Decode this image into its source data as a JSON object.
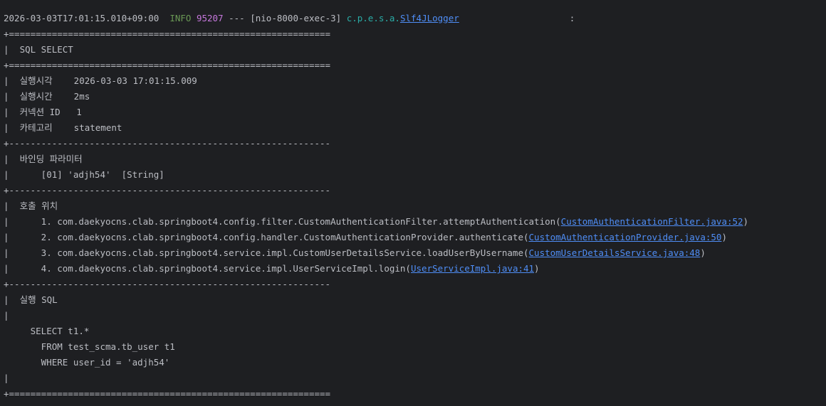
{
  "header": {
    "timestamp": "2026-03-03T17:01:15.010+09:00",
    "level": "INFO",
    "pid": "95207",
    "separator": "---",
    "thread": "[nio-8000-exec-3]",
    "logger_prefix": "c.p.e.s.a.",
    "logger_class": "Slf4JLogger",
    "colon": ":"
  },
  "borders": {
    "double": "+============================================================",
    "single": "+------------------------------------------------------------"
  },
  "title": "|  SQL SELECT",
  "meta": [
    "|  실행시각    2026-03-03 17:01:15.009",
    "|  실행시간    2ms",
    "|  커넥션 ID   1",
    "|  카테고리    statement"
  ],
  "binding": {
    "heading": "|  바인딩 파라미터",
    "params": [
      "|      [01] 'adjh54'  [String]"
    ]
  },
  "call_location": {
    "heading": "|  호출 위치",
    "frames": [
      {
        "prefix": "|      1. com.daekyocns.clab.springboot4.config.filter.CustomAuthenticationFilter.attemptAuthentication(",
        "link": "CustomAuthenticationFilter.java:52",
        "suffix": ")"
      },
      {
        "prefix": "|      2. com.daekyocns.clab.springboot4.config.handler.CustomAuthenticationProvider.authenticate(",
        "link": "CustomAuthenticationProvider.java:50",
        "suffix": ")"
      },
      {
        "prefix": "|      3. com.daekyocns.clab.springboot4.service.impl.CustomUserDetailsService.loadUserByUsername(",
        "link": "CustomUserDetailsService.java:48",
        "suffix": ")"
      },
      {
        "prefix": "|      4. com.daekyocns.clab.springboot4.service.impl.UserServiceImpl.login(",
        "link": "UserServiceImpl.java:41",
        "suffix": ")"
      }
    ]
  },
  "sql": {
    "heading": "|  실행 SQL",
    "pipe": "|",
    "lines": [
      "     SELECT t1.*",
      "       FROM test_scma.tb_user t1",
      "       WHERE user_id = 'adjh54'"
    ]
  },
  "colors": {
    "background": "#1e1f22",
    "text": "#bcbec4",
    "info": "#6a9955",
    "pid": "#c678dd",
    "logger": "#2aaca6",
    "link": "#4f8ef7"
  }
}
